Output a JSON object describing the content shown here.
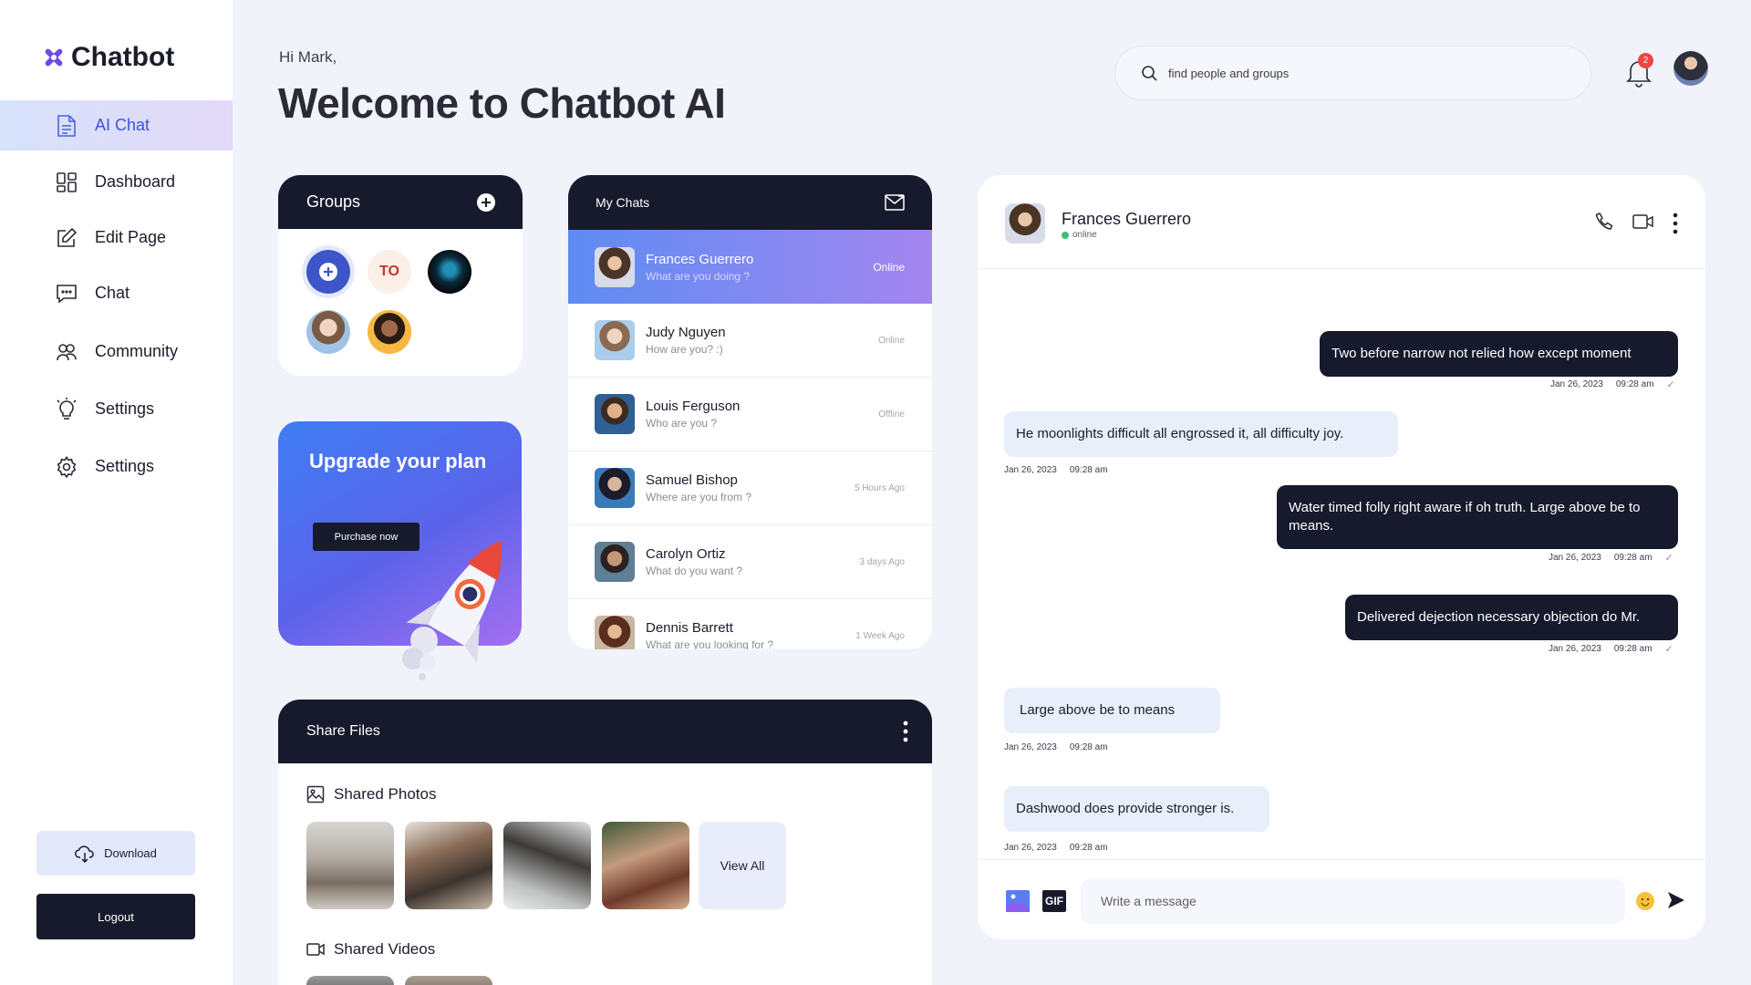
{
  "brand": {
    "name": "Chatbot",
    "accent": "#5b4de8"
  },
  "sidebar": {
    "items": [
      {
        "label": "AI Chat",
        "icon": "document-icon",
        "active": true
      },
      {
        "label": "Dashboard",
        "icon": "dashboard-grid-icon"
      },
      {
        "label": "Edit Page",
        "icon": "edit-icon"
      },
      {
        "label": "Chat",
        "icon": "chat-icon"
      },
      {
        "label": "Community",
        "icon": "community-icon"
      },
      {
        "label": "Settings",
        "icon": "bulb-icon"
      },
      {
        "label": "Settings",
        "icon": "gear-icon"
      }
    ],
    "download_label": "Download",
    "logout_label": "Logout"
  },
  "header": {
    "greeting": "Hi Mark,",
    "title": "Welcome to Chatbot AI",
    "search_placeholder": "find people and groups",
    "notification_count": "2"
  },
  "groups": {
    "title": "Groups",
    "initials_avatar": "TO"
  },
  "upgrade": {
    "title": "Upgrade your plan",
    "button_label": "Purchase now"
  },
  "my_chats": {
    "title": "My Chats",
    "items": [
      {
        "name": "Frances Guerrero",
        "message": "What are you doing ?",
        "status": "Online",
        "active": true
      },
      {
        "name": "Judy Nguyen",
        "message": "How are you? :)",
        "status": "Online"
      },
      {
        "name": "Louis Ferguson",
        "message": "Who are you ?",
        "status": "Offline"
      },
      {
        "name": "Samuel Bishop",
        "message": "Where are you from ?",
        "status": "5 Hours Ago"
      },
      {
        "name": "Carolyn Ortiz",
        "message": "What do you want ?",
        "status": "3 days Ago"
      },
      {
        "name": "Dennis Barrett",
        "message": "What are you looking for ?",
        "status": "1 Week Ago"
      }
    ]
  },
  "share_files": {
    "title": "Share Files",
    "photos_label": "Shared Photos",
    "view_all_label": "View All",
    "videos_label": "Shared Videos"
  },
  "conversation": {
    "contact_name": "Frances Guerrero",
    "contact_status": "online",
    "messages": [
      {
        "direction": "out",
        "text": "Two before narrow not relied how except moment",
        "date": "Jan 26, 2023",
        "time": "09:28 am"
      },
      {
        "direction": "in",
        "text": "He moonlights difficult all engrossed it, all difficulty joy.",
        "date": "Jan 26, 2023",
        "time": "09:28 am"
      },
      {
        "direction": "out",
        "text": "Water timed folly right aware if oh truth. Large above be to means.",
        "date": "Jan 26, 2023",
        "time": "09:28 am"
      },
      {
        "direction": "out",
        "text": "Delivered dejection necessary objection do Mr.",
        "date": "Jan 26, 2023",
        "time": "09:28 am"
      },
      {
        "direction": "in",
        "text": "Large above be to means",
        "date": "Jan 26, 2023",
        "time": "09:28 am"
      },
      {
        "direction": "in",
        "text": "Dashwood does provide stronger is.",
        "date": "Jan 26, 2023",
        "time": "09:28 am"
      }
    ],
    "composer_placeholder": "Write a message",
    "gif_label": "GIF"
  }
}
